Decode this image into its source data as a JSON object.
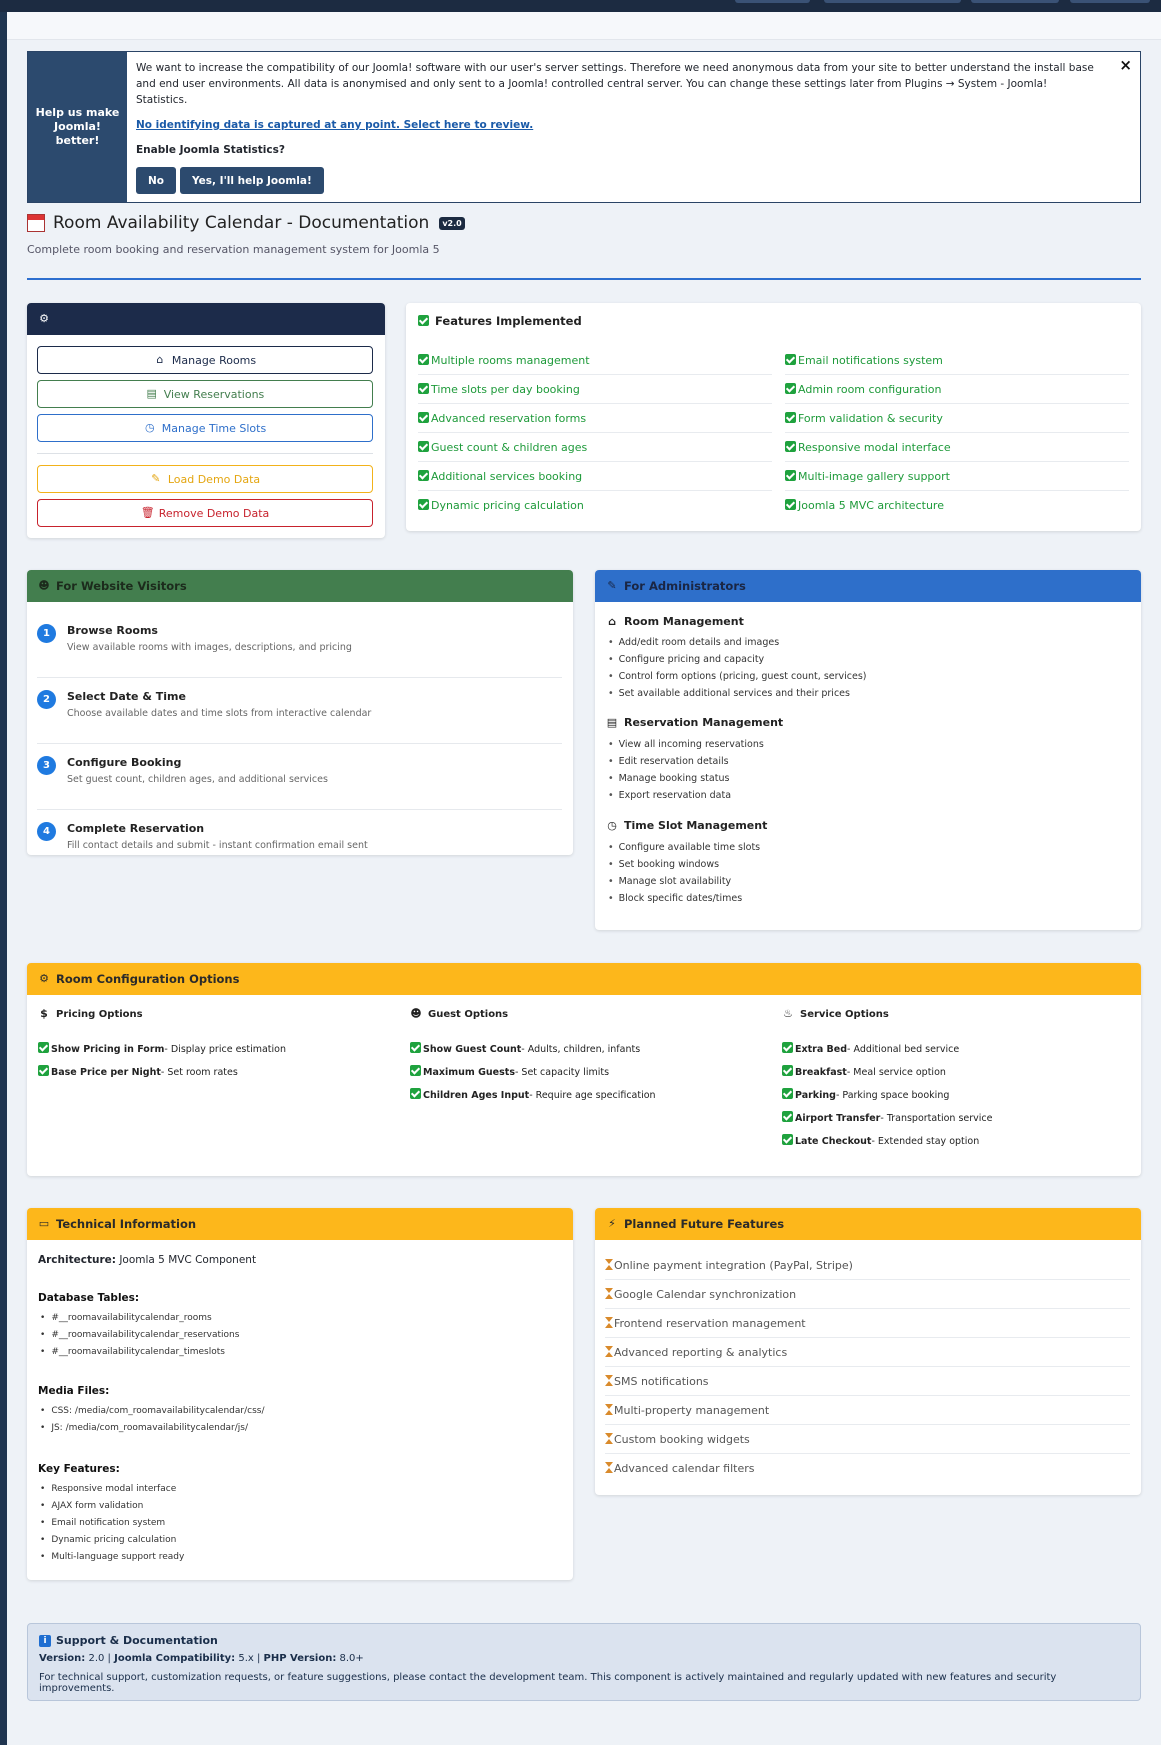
{
  "stats": {
    "side": "Help us make Joomla! better!",
    "message": "We want to increase the compatibility of our Joomla! software with our user's server settings. Therefore we need anonymous data from your site to better understand the install base and end user environments. All data is anonymised and only sent to a Joomla! controlled central server. You can change these settings later from Plugins → System - Joomla! Statistics.",
    "link": "No identifying data is captured at any point. Select here to review.",
    "question": "Enable Joomla Statistics?",
    "no": "No",
    "yes": "Yes, I'll help Joomla!",
    "close": "×"
  },
  "header": {
    "title": "Room Availability Calendar - Documentation",
    "version": "v2.0",
    "subtitle": "Complete room booking and reservation management system for Joomla 5"
  },
  "quick_actions": {
    "title": "",
    "buttons": [
      "Manage Rooms",
      "View Reservations",
      "Manage Time Slots",
      "Load Demo Data",
      "Remove Demo Data"
    ]
  },
  "features": {
    "title": "Features Implemented",
    "left": [
      "Multiple rooms management",
      "Time slots per day booking",
      "Advanced reservation forms",
      "Guest count & children ages",
      "Additional services booking",
      "Dynamic pricing calculation"
    ],
    "right": [
      "Email notifications system",
      "Admin room configuration",
      "Form validation & security",
      "Responsive modal interface",
      "Multi-image gallery support",
      "Joomla 5 MVC architecture"
    ]
  },
  "visitors": {
    "title": "For Website Visitors",
    "steps": [
      {
        "num": "1",
        "title": "Browse Rooms",
        "desc": "View available rooms with images, descriptions, and pricing"
      },
      {
        "num": "2",
        "title": "Select Date & Time",
        "desc": "Choose available dates and time slots from interactive calendar"
      },
      {
        "num": "3",
        "title": "Configure Booking",
        "desc": "Set guest count, children ages, and additional services"
      },
      {
        "num": "4",
        "title": "Complete Reservation",
        "desc": "Fill contact details and submit - instant confirmation email sent"
      }
    ]
  },
  "admins": {
    "title": "For Administrators",
    "sections": [
      {
        "title": "Room Management",
        "items": [
          "Add/edit room details and images",
          "Configure pricing and capacity",
          "Control form options (pricing, guest count, services)",
          "Set available additional services and their prices"
        ]
      },
      {
        "title": "Reservation Management",
        "items": [
          "View all incoming reservations",
          "Edit reservation details",
          "Manage booking status",
          "Export reservation data"
        ]
      },
      {
        "title": "Time Slot Management",
        "items": [
          "Configure available time slots",
          "Set booking windows",
          "Manage slot availability",
          "Block specific dates/times"
        ]
      }
    ]
  },
  "config": {
    "title": "Room Configuration Options",
    "pricing": {
      "title": "Pricing Options",
      "items": [
        [
          "Show Pricing in Form",
          "- Display price estimation"
        ],
        [
          "Base Price per Night",
          "- Set room rates"
        ]
      ]
    },
    "guest": {
      "title": "Guest Options",
      "items": [
        [
          "Show Guest Count",
          "- Adults, children, infants"
        ],
        [
          "Maximum Guests",
          "- Set capacity limits"
        ],
        [
          "Children Ages Input",
          "- Require age specification"
        ]
      ]
    },
    "service": {
      "title": "Service Options",
      "items": [
        [
          "Extra Bed",
          "- Additional bed service"
        ],
        [
          "Breakfast",
          "- Meal service option"
        ],
        [
          "Parking",
          "- Parking space booking"
        ],
        [
          "Airport Transfer",
          "- Transportation service"
        ],
        [
          "Late Checkout",
          "- Extended stay option"
        ]
      ]
    }
  },
  "tech": {
    "title": "Technical Information",
    "arch_label": "Architecture:",
    "arch_value": "Joomla 5 MVC Component",
    "db_title": "Database Tables:",
    "db": [
      "#__roomavailabilitycalendar_rooms",
      "#__roomavailabilitycalendar_reservations",
      "#__roomavailabilitycalendar_timeslots"
    ],
    "media_title": "Media Files:",
    "media": [
      "CSS: /media/com_roomavailabilitycalendar/css/",
      "JS: /media/com_roomavailabilitycalendar/js/"
    ],
    "key_title": "Key Features:",
    "key": [
      "Responsive modal interface",
      "AJAX form validation",
      "Email notification system",
      "Dynamic pricing calculation",
      "Multi-language support ready"
    ]
  },
  "future": {
    "title": "Planned Future Features",
    "items": [
      "Online payment integration (PayPal, Stripe)",
      "Google Calendar synchronization",
      "Frontend reservation management",
      "Advanced reporting & analytics",
      "SMS notifications",
      "Multi-property management",
      "Custom booking widgets",
      "Advanced calendar filters"
    ]
  },
  "support": {
    "title": "Support & Documentation",
    "version_label": "Version:",
    "version": "2.0",
    "compat_label": "Joomla Compatibility:",
    "compat": "5.x",
    "php_label": "PHP Version:",
    "php": "8.0+",
    "text": "For technical support, customization requests, or feature suggestions, please contact the development team. This component is actively maintained and regularly updated with new features and security improvements."
  }
}
